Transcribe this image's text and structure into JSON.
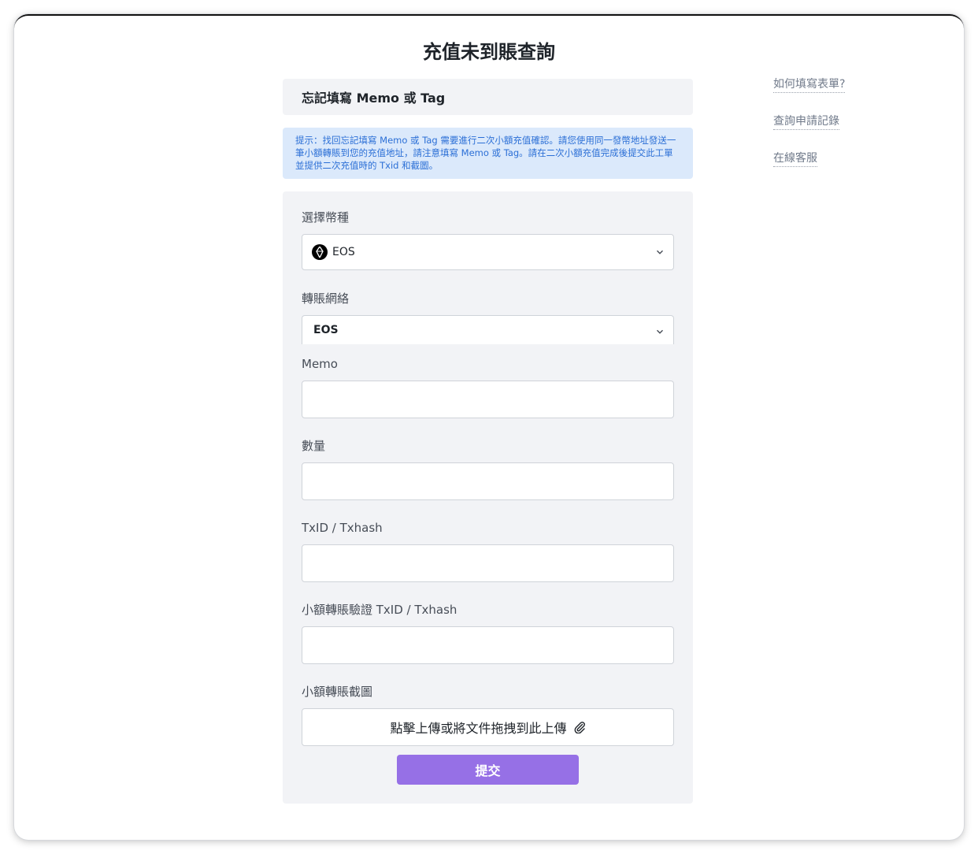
{
  "page": {
    "title": "充值未到賬查詢"
  },
  "section": {
    "header": "忘記填寫 Memo 或 Tag"
  },
  "notice": {
    "text": "提示：找回忘記填寫 Memo 或 Tag 需要進行二次小額充值確認。請您使用同一發幣地址發送一筆小額轉賬到您的充值地址，請注意填寫 Memo 或 Tag。請在二次小額充值完成後提交此工單並提供二次充值時的 Txid 和截圖。"
  },
  "form": {
    "coin_label": "選擇幣種",
    "coin_value": "EOS",
    "coin_icon": "eos-coin-icon",
    "network_label": "轉賬網絡",
    "network_value": "EOS",
    "memo_label": "Memo",
    "memo_value": "",
    "amount_label": "數量",
    "amount_value": "",
    "txid_label": "TxID / Txhash",
    "txid_value": "",
    "verify_txid_label": "小額轉賬驗證 TxID / Txhash",
    "verify_txid_value": "",
    "screenshot_label": "小額轉賬截圖",
    "upload_text": "點擊上傳或將文件拖拽到此上傳",
    "submit_label": "提交"
  },
  "side_links": [
    {
      "label": "如何填寫表單?"
    },
    {
      "label": "查詢申請記錄"
    },
    {
      "label": "在線客服"
    }
  ],
  "colors": {
    "accent": "#9670e6",
    "notice_bg": "#dbe9fb",
    "notice_text": "#2b6fd6",
    "card_bg": "#f2f3f6"
  }
}
